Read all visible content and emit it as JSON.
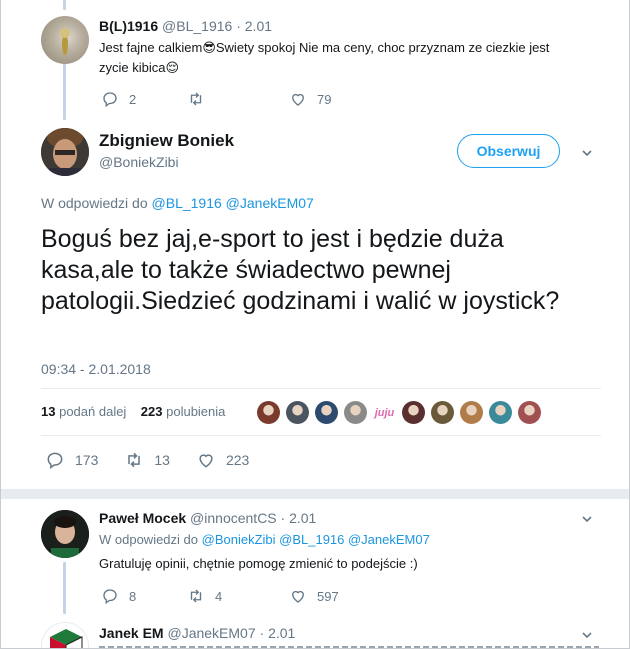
{
  "reply1": {
    "name": "B(L)1916",
    "handle": "@BL_1916",
    "date": "2.01",
    "text_line1": "Jest fajne calkiem😎Swiety spokoj Nie ma ceny, choc przyznam ze ciezkie jest",
    "text_line2": "zycie kibica😌",
    "replies": "2",
    "retweets": "",
    "likes": "79"
  },
  "main": {
    "name": "Zbigniew Boniek",
    "handle": "@BoniekZibi",
    "follow_label": "Obserwuj",
    "replying_prefix": "W odpowiedzi do",
    "replying_to": "@BL_1916 @JanekEM07",
    "text": "Boguś bez jaj,e-sport to jest i będzie duża kasa,ale to także świadectwo pewnej patologii.Siedzieć godzinami i walić w joystick?",
    "timestamp": "09:34 - 2.01.2018",
    "retweet_count": "13",
    "retweet_label": "podań dalej",
    "like_count": "223",
    "like_label": "polubienia",
    "action_replies": "173",
    "action_retweets": "13",
    "action_likes": "223",
    "liker_colors": [
      "#7a3b2e",
      "#4a5560",
      "#2d4b6e",
      "#8a8a8a",
      "#e06ab0",
      "#5a2f2f",
      "#6b5a3a",
      "#b07d4a",
      "#3a8a9a",
      "#a05050"
    ],
    "liker_text": "juju"
  },
  "reply2": {
    "name": "Paweł Mocek",
    "handle": "@innocentCS",
    "date": "2.01",
    "replying_prefix": "W odpowiedzi do",
    "replying_to": "@BoniekZibi @BL_1916 @JanekEM07",
    "text": "Gratuluję opinii, chętnie pomogę zmienić to podejście :)",
    "replies": "8",
    "retweets": "4",
    "likes": "597"
  },
  "reply3": {
    "name": "Janek EM",
    "handle": "@JanekEM07",
    "date": "2.01"
  }
}
